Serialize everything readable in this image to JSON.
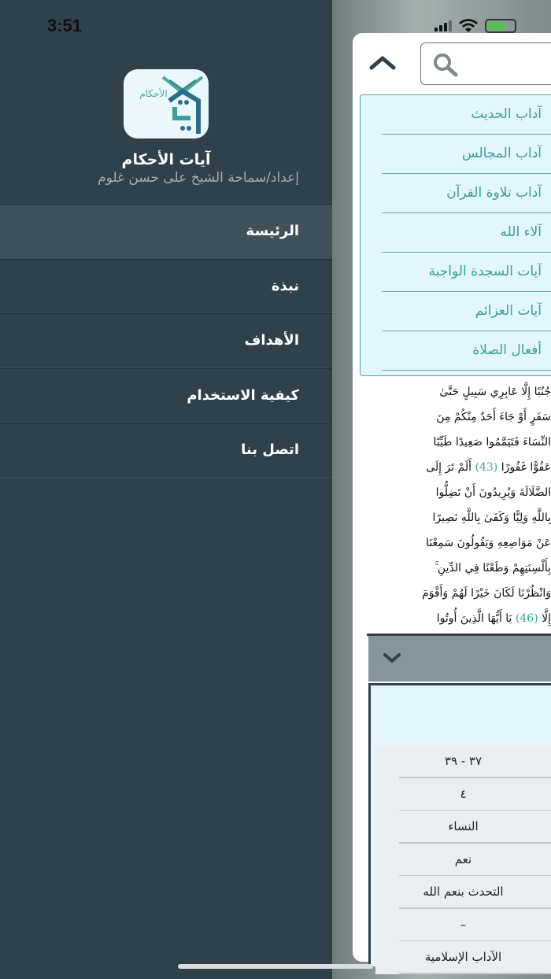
{
  "status": {
    "time": "3:51"
  },
  "sidebar": {
    "app_title": "آيات الأحكام",
    "logo_text": "الأحكام",
    "subtitle": "إعداد/سماحة الشيخ على حسن غلوم",
    "menu": [
      {
        "label": "الرئيسة",
        "active": true
      },
      {
        "label": "نبذة"
      },
      {
        "label": "الأهداف"
      },
      {
        "label": "كيفية الاستخدام"
      },
      {
        "label": "اتصل بنا"
      }
    ]
  },
  "main": {
    "dropdown": [
      "آداب الحديث",
      "آداب المجالس",
      "آداب تلاوة القرآن",
      "آلاء الله",
      "آيات السجدة الواجبة",
      "آيات العزائم",
      "أفعال الصلاة"
    ],
    "quran_lines": [
      {
        "text": "جُنُبًا إِلَّا عَابِرِي سَبِيلٍ حَتَّىٰ"
      },
      {
        "text": "سَفَرٍ أَوْ جَاءَ أَحَدٌ مِنْكُمْ مِنَ"
      },
      {
        "text": "النِّسَاءَ فَتَيَمَّمُوا صَعِيدًا طَيِّبًا"
      },
      {
        "text": "عَفُوًّا غَفُورًا ",
        "num": "(43)",
        "after": " أَلَمْ تَرَ إِلَى"
      },
      {
        "text": "الضَّلَالَةَ وَيُرِيدُونَ أَنْ تَضِلُّوا"
      },
      {
        "text": "بِاللَّهِ وَلِيًّا وَكَفَىٰ بِاللَّهِ نَصِيرًا"
      },
      {
        "text": "عَنْ مَوَاضِعِهِ وَيَقُولُونَ سَمِعْنَا"
      },
      {
        "text": "بِأَلْسِنَتِهِمْ وَطَعْنًا فِي الدِّينِ ۚ"
      },
      {
        "text": "وَانْظُرْنَا لَكَانَ خَيْرًا لَهُمْ وَأَقْوَمَ"
      },
      {
        "text": "إِلَّا ",
        "num": "(46)",
        "after": " يَا أَيُّهَا الَّذِينَ أُوتُوا"
      }
    ],
    "details": [
      "٣٧ - ٣٩",
      "٤",
      "النساء",
      "نعم",
      "التحدث بنعم الله",
      "–",
      "الآداب الإسلامية"
    ]
  }
}
